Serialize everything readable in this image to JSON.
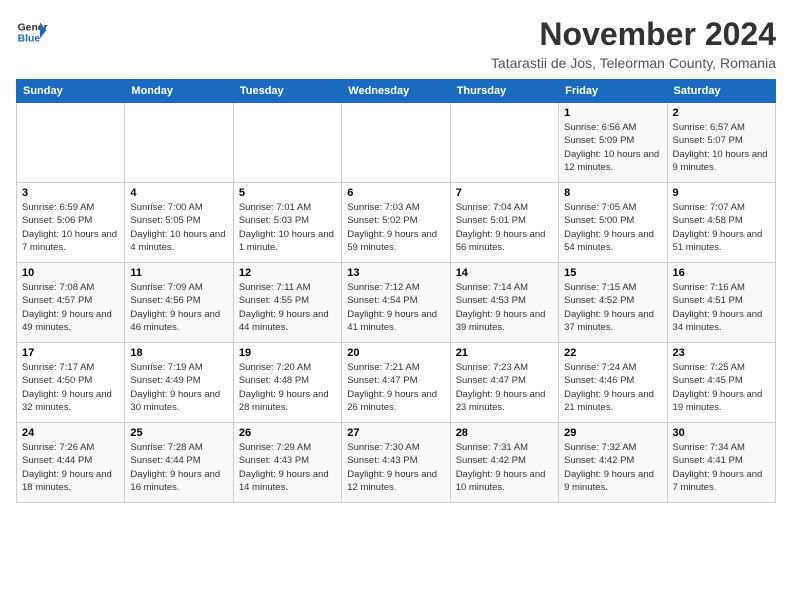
{
  "logo": {
    "line1": "General",
    "line2": "Blue"
  },
  "header": {
    "month_year": "November 2024",
    "location": "Tatarastii de Jos, Teleorman County, Romania"
  },
  "days_of_week": [
    "Sunday",
    "Monday",
    "Tuesday",
    "Wednesday",
    "Thursday",
    "Friday",
    "Saturday"
  ],
  "weeks": [
    [
      {
        "day": "",
        "info": ""
      },
      {
        "day": "",
        "info": ""
      },
      {
        "day": "",
        "info": ""
      },
      {
        "day": "",
        "info": ""
      },
      {
        "day": "",
        "info": ""
      },
      {
        "day": "1",
        "info": "Sunrise: 6:56 AM\nSunset: 5:09 PM\nDaylight: 10 hours and 12 minutes."
      },
      {
        "day": "2",
        "info": "Sunrise: 6:57 AM\nSunset: 5:07 PM\nDaylight: 10 hours and 9 minutes."
      }
    ],
    [
      {
        "day": "3",
        "info": "Sunrise: 6:59 AM\nSunset: 5:06 PM\nDaylight: 10 hours and 7 minutes."
      },
      {
        "day": "4",
        "info": "Sunrise: 7:00 AM\nSunset: 5:05 PM\nDaylight: 10 hours and 4 minutes."
      },
      {
        "day": "5",
        "info": "Sunrise: 7:01 AM\nSunset: 5:03 PM\nDaylight: 10 hours and 1 minute."
      },
      {
        "day": "6",
        "info": "Sunrise: 7:03 AM\nSunset: 5:02 PM\nDaylight: 9 hours and 59 minutes."
      },
      {
        "day": "7",
        "info": "Sunrise: 7:04 AM\nSunset: 5:01 PM\nDaylight: 9 hours and 56 minutes."
      },
      {
        "day": "8",
        "info": "Sunrise: 7:05 AM\nSunset: 5:00 PM\nDaylight: 9 hours and 54 minutes."
      },
      {
        "day": "9",
        "info": "Sunrise: 7:07 AM\nSunset: 4:58 PM\nDaylight: 9 hours and 51 minutes."
      }
    ],
    [
      {
        "day": "10",
        "info": "Sunrise: 7:08 AM\nSunset: 4:57 PM\nDaylight: 9 hours and 49 minutes."
      },
      {
        "day": "11",
        "info": "Sunrise: 7:09 AM\nSunset: 4:56 PM\nDaylight: 9 hours and 46 minutes."
      },
      {
        "day": "12",
        "info": "Sunrise: 7:11 AM\nSunset: 4:55 PM\nDaylight: 9 hours and 44 minutes."
      },
      {
        "day": "13",
        "info": "Sunrise: 7:12 AM\nSunset: 4:54 PM\nDaylight: 9 hours and 41 minutes."
      },
      {
        "day": "14",
        "info": "Sunrise: 7:14 AM\nSunset: 4:53 PM\nDaylight: 9 hours and 39 minutes."
      },
      {
        "day": "15",
        "info": "Sunrise: 7:15 AM\nSunset: 4:52 PM\nDaylight: 9 hours and 37 minutes."
      },
      {
        "day": "16",
        "info": "Sunrise: 7:16 AM\nSunset: 4:51 PM\nDaylight: 9 hours and 34 minutes."
      }
    ],
    [
      {
        "day": "17",
        "info": "Sunrise: 7:17 AM\nSunset: 4:50 PM\nDaylight: 9 hours and 32 minutes."
      },
      {
        "day": "18",
        "info": "Sunrise: 7:19 AM\nSunset: 4:49 PM\nDaylight: 9 hours and 30 minutes."
      },
      {
        "day": "19",
        "info": "Sunrise: 7:20 AM\nSunset: 4:48 PM\nDaylight: 9 hours and 28 minutes."
      },
      {
        "day": "20",
        "info": "Sunrise: 7:21 AM\nSunset: 4:47 PM\nDaylight: 9 hours and 26 minutes."
      },
      {
        "day": "21",
        "info": "Sunrise: 7:23 AM\nSunset: 4:47 PM\nDaylight: 9 hours and 23 minutes."
      },
      {
        "day": "22",
        "info": "Sunrise: 7:24 AM\nSunset: 4:46 PM\nDaylight: 9 hours and 21 minutes."
      },
      {
        "day": "23",
        "info": "Sunrise: 7:25 AM\nSunset: 4:45 PM\nDaylight: 9 hours and 19 minutes."
      }
    ],
    [
      {
        "day": "24",
        "info": "Sunrise: 7:26 AM\nSunset: 4:44 PM\nDaylight: 9 hours and 18 minutes."
      },
      {
        "day": "25",
        "info": "Sunrise: 7:28 AM\nSunset: 4:44 PM\nDaylight: 9 hours and 16 minutes."
      },
      {
        "day": "26",
        "info": "Sunrise: 7:29 AM\nSunset: 4:43 PM\nDaylight: 9 hours and 14 minutes."
      },
      {
        "day": "27",
        "info": "Sunrise: 7:30 AM\nSunset: 4:43 PM\nDaylight: 9 hours and 12 minutes."
      },
      {
        "day": "28",
        "info": "Sunrise: 7:31 AM\nSunset: 4:42 PM\nDaylight: 9 hours and 10 minutes."
      },
      {
        "day": "29",
        "info": "Sunrise: 7:32 AM\nSunset: 4:42 PM\nDaylight: 9 hours and 9 minutes."
      },
      {
        "day": "30",
        "info": "Sunrise: 7:34 AM\nSunset: 4:41 PM\nDaylight: 9 hours and 7 minutes."
      }
    ]
  ]
}
